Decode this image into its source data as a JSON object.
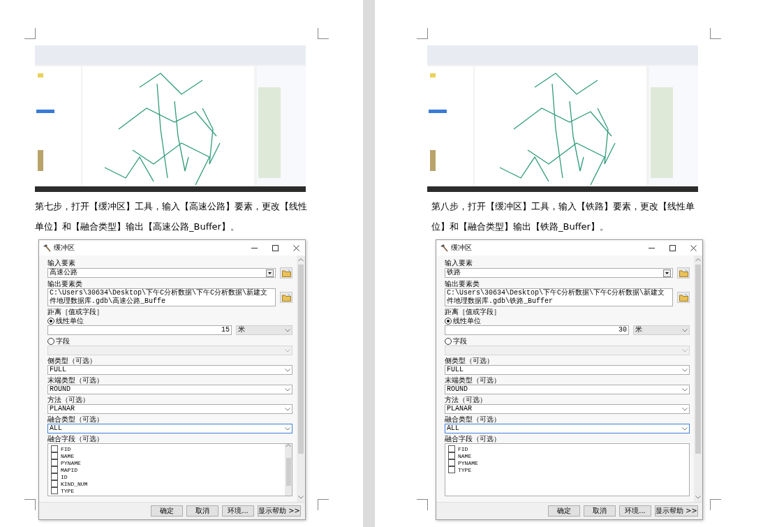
{
  "pages": [
    {
      "step_text": "第七步，打开【缓冲区】工具，输入【高速公路】要素，更改【线性单位】和【融合类型】输出【高速公路_Buffer】。",
      "dialog": {
        "title": "缓冲区",
        "input_label": "输入要素",
        "input_value": "高速公路",
        "output_label": "输出要素类",
        "output_value": "C:\\Users\\30634\\Desktop\\下午C分析数据\\下午C分析数据\\新建文件地理数据库.gdb\\高速公路_Buffe",
        "distance_label": "距离［值或字段］",
        "radios": [
          {
            "label": "线性单位",
            "selected": true
          },
          {
            "label": "字段",
            "selected": false
          }
        ],
        "distance_value": "15",
        "unit": "米",
        "options": [
          {
            "label": "侧类型（可选）",
            "value": "FULL",
            "focused": false
          },
          {
            "label": "末端类型（可选）",
            "value": "ROUND",
            "focused": false
          },
          {
            "label": "方法（可选）",
            "value": "PLANAR",
            "focused": false
          },
          {
            "label": "融合类型（可选）",
            "value": "ALL",
            "focused": true
          }
        ],
        "fields_label": "融合字段（可选）",
        "fields": [
          {
            "label": "FID",
            "checked": false
          },
          {
            "label": "NAME",
            "checked": false
          },
          {
            "label": "PYNAME",
            "checked": false
          },
          {
            "label": "MAPID",
            "checked": false
          },
          {
            "label": "ID",
            "checked": false
          },
          {
            "label": "KIND_NUM",
            "checked": false
          },
          {
            "label": "TYPE",
            "checked": false
          }
        ],
        "buttons": [
          "确定",
          "取消",
          "环境...",
          "显示帮助 >>"
        ]
      }
    },
    {
      "step_text": "第八步，打开【缓冲区】工具，输入【铁路】要素，更改【线性单位】和【融合类型】输出【铁路_Buffer】。",
      "dialog": {
        "title": "缓冲区",
        "input_label": "输入要素",
        "input_value": "铁路",
        "output_label": "输出要素类",
        "output_value": "C:\\Users\\30634\\Desktop\\下午C分析数据\\下午C分析数据\\新建文件地理数据库.gdb\\铁路_Buffer",
        "distance_label": "距离［值或字段］",
        "radios": [
          {
            "label": "线性单位",
            "selected": true
          },
          {
            "label": "字段",
            "selected": false
          }
        ],
        "distance_value": "30",
        "unit": "米",
        "options": [
          {
            "label": "侧类型（可选）",
            "value": "FULL",
            "focused": false
          },
          {
            "label": "末端类型（可选）",
            "value": "ROUND",
            "focused": false
          },
          {
            "label": "方法（可选）",
            "value": "PLANAR",
            "focused": false
          },
          {
            "label": "融合类型（可选）",
            "value": "ALL",
            "focused": true
          }
        ],
        "fields_label": "融合字段（可选）",
        "fields": [
          {
            "label": "FID",
            "checked": false
          },
          {
            "label": "NAME",
            "checked": false
          },
          {
            "label": "PYNAME",
            "checked": false
          },
          {
            "label": "TYPE",
            "checked": false
          }
        ],
        "buttons": [
          "确定",
          "取消",
          "环境...",
          "显示帮助 >>"
        ]
      }
    }
  ]
}
